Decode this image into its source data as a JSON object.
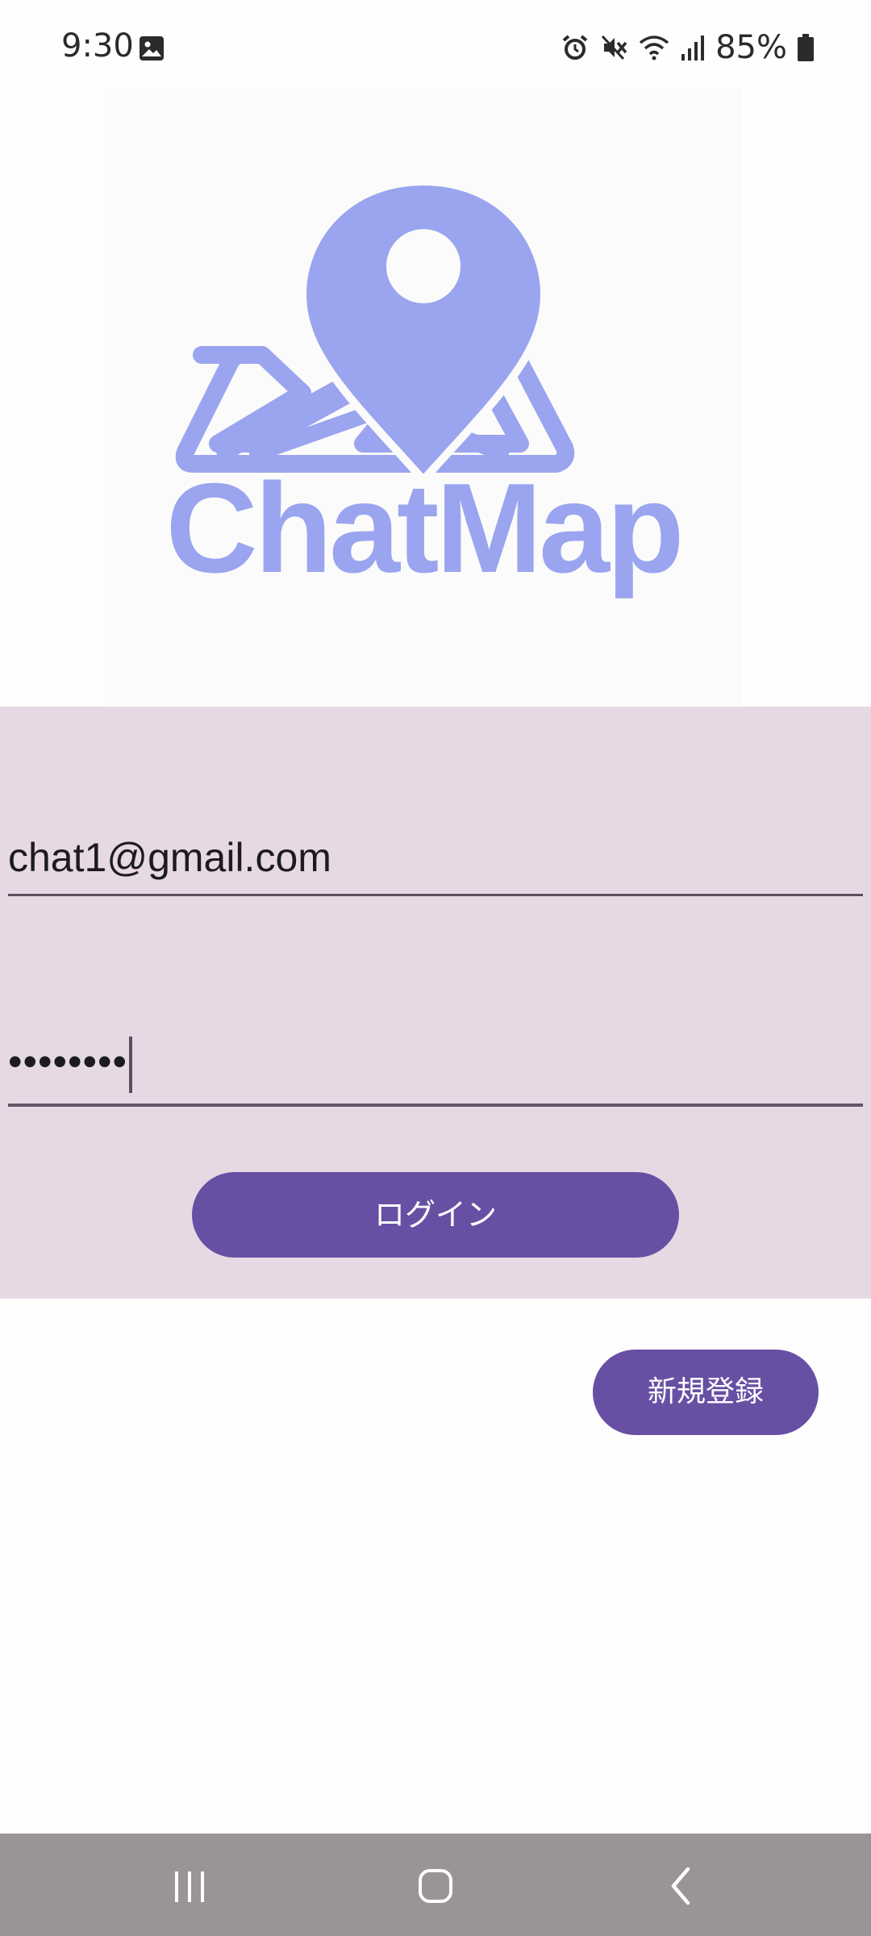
{
  "status_bar": {
    "time": "9:30",
    "battery_percent": "85%",
    "icons": [
      "image-icon",
      "alarm-icon",
      "mute-icon",
      "wifi-icon",
      "signal-icon",
      "battery-icon"
    ]
  },
  "logo": {
    "text": "ChatMap",
    "color": "#9aa4ef",
    "icon": "map-pin-icon"
  },
  "form": {
    "email_value": "chat1@gmail.com",
    "password_value": "••••••••",
    "login_label": "ログイン"
  },
  "register": {
    "label": "新規登録"
  },
  "nav_bar": {
    "icons": [
      "recent-apps-icon",
      "home-icon",
      "back-icon"
    ]
  },
  "colors": {
    "accent": "#6750a4",
    "form_background": "#e6d9e3",
    "nav_background": "#999497"
  }
}
